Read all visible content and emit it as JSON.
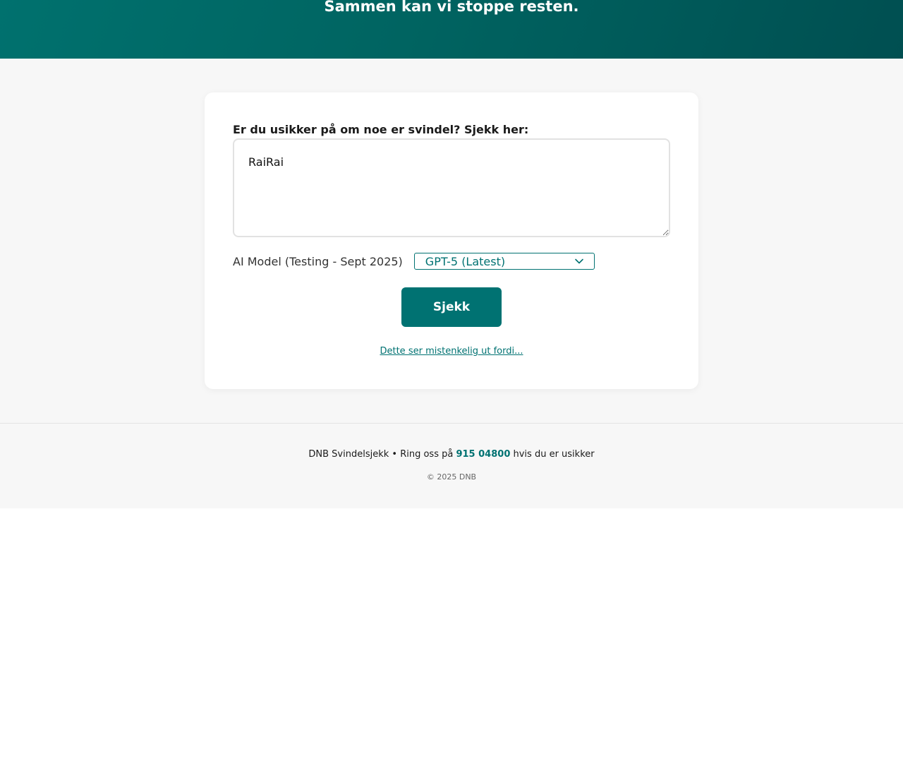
{
  "hero": {
    "title": "Sammen kan vi stoppe resten."
  },
  "form": {
    "question_label": "Er du usikker på om noe er svindel? Sjekk her:",
    "message_value": "RaiRai",
    "model_label": "AI Model (Testing - Sept 2025)",
    "model_selected": "GPT-5 (Latest)",
    "check_button_label": "Sjekk",
    "suspicious_link": "Dette ser mistenkelig ut fordi..."
  },
  "footer": {
    "text_before": "DNB Svindelsjekk • Ring oss på ",
    "phone": "915 04800",
    "text_after": " hvis du er usikker",
    "copyright": "© 2025 DNB"
  },
  "colors": {
    "brand": "#007272",
    "hero_dark": "#004f51",
    "background": "#f7f7f7"
  },
  "icons": {
    "select_chevron": "chevron-down-icon"
  }
}
